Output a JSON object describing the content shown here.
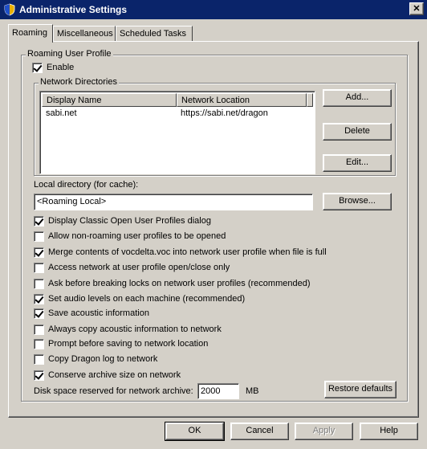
{
  "window": {
    "title": "Administrative Settings",
    "close_label": "✕"
  },
  "tabs": [
    {
      "label": "Roaming"
    },
    {
      "label": "Miscellaneous"
    },
    {
      "label": "Scheduled Tasks"
    }
  ],
  "roaming_group": {
    "legend": "Roaming User Profile",
    "enable_label": "Enable",
    "enable_checked": true
  },
  "network_directories": {
    "legend": "Network Directories",
    "columns": [
      "Display Name",
      "Network Location"
    ],
    "rows": [
      {
        "display_name": "sabi.net",
        "network_location": "https://sabi.net/dragon"
      }
    ],
    "add_label": "Add...",
    "delete_label": "Delete",
    "edit_label": "Edit..."
  },
  "local_directory": {
    "label": "Local directory (for cache):",
    "value": "<Roaming Local>",
    "browse_label": "Browse..."
  },
  "options": [
    {
      "label": "Display Classic Open User Profiles dialog",
      "checked": true
    },
    {
      "label": "Allow non-roaming user profiles to be opened",
      "checked": false
    },
    {
      "label": "Merge contents of vocdelta.voc into network user profile when file is full",
      "checked": true
    },
    {
      "label": "Access network at user profile open/close only",
      "checked": false
    },
    {
      "label": "Ask before breaking locks on network user profiles (recommended)",
      "checked": false
    },
    {
      "label": "Set audio levels on each machine (recommended)",
      "checked": true
    },
    {
      "label": "Save acoustic information",
      "checked": true
    },
    {
      "label": "Always copy acoustic information to network",
      "checked": false
    },
    {
      "label": "Prompt before saving to network location",
      "checked": false
    },
    {
      "label": "Copy Dragon log to network",
      "checked": false
    },
    {
      "label": "Conserve archive size on network",
      "checked": true
    }
  ],
  "disk_space": {
    "label": "Disk space reserved for network archive:",
    "value": "2000",
    "unit": "MB"
  },
  "restore_defaults_label": "Restore defaults",
  "footer": {
    "ok_label": "OK",
    "cancel_label": "Cancel",
    "apply_label": "Apply",
    "help_label": "Help"
  }
}
